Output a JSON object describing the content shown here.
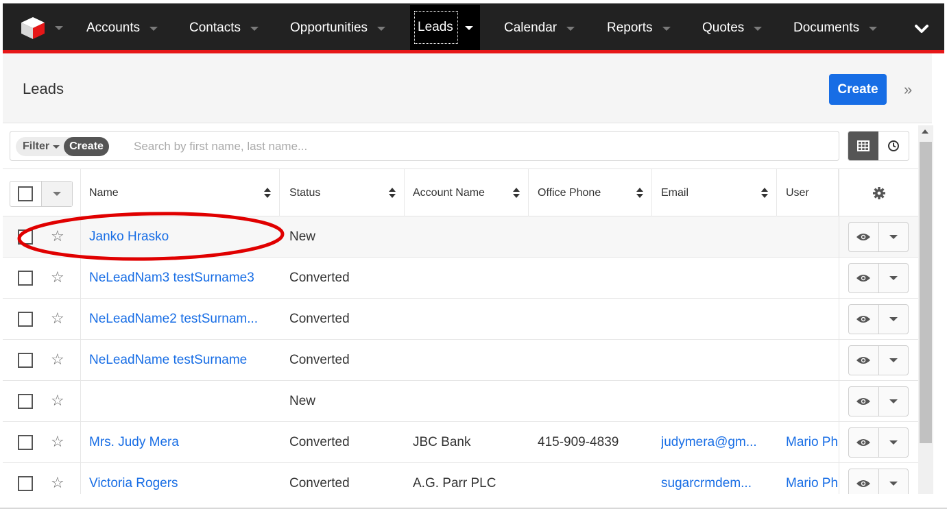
{
  "nav": {
    "logo_icon": "sugarcube-logo-icon",
    "items": [
      {
        "label": "Accounts"
      },
      {
        "label": "Contacts"
      },
      {
        "label": "Opportunities"
      },
      {
        "label": "Leads",
        "active": true
      },
      {
        "label": "Calendar"
      },
      {
        "label": "Reports"
      },
      {
        "label": "Quotes"
      },
      {
        "label": "Documents"
      }
    ],
    "more_icon": "chevron-down-icon"
  },
  "header": {
    "title": "Leads",
    "create_label": "Create",
    "collapse_icon": "double-chevron-right-icon"
  },
  "filter": {
    "filter_label": "Filter",
    "create_label": "Create",
    "search_placeholder": "Search by first name, last name...",
    "views": [
      {
        "icon": "grid-icon",
        "active": true
      },
      {
        "icon": "clock-icon",
        "active": false
      }
    ]
  },
  "table": {
    "columns": [
      "Name",
      "Status",
      "Account Name",
      "Office Phone",
      "Email",
      "User"
    ],
    "settings_icon": "gear-icon",
    "rows": [
      {
        "name": "Janko Hrasko",
        "status": "New",
        "account": "",
        "phone": "",
        "email": "",
        "user": "",
        "highlighted": true
      },
      {
        "name": "NeLeadNam3 testSurname3",
        "status": "Converted",
        "account": "",
        "phone": "",
        "email": "",
        "user": ""
      },
      {
        "name": "NeLeadName2 testSurnam...",
        "status": "Converted",
        "account": "",
        "phone": "",
        "email": "",
        "user": ""
      },
      {
        "name": "NeLeadName testSurname",
        "status": "Converted",
        "account": "",
        "phone": "",
        "email": "",
        "user": ""
      },
      {
        "name": "",
        "status": "New",
        "account": "",
        "phone": "",
        "email": "",
        "user": ""
      },
      {
        "name": "Mrs. Judy Mera",
        "status": "Converted",
        "account": "JBC Bank",
        "phone": "415-909-4839",
        "email": "judymera@gm...",
        "user": "Mario Ph"
      },
      {
        "name": "Victoria Rogers",
        "status": "Converted",
        "account": "A.G. Parr PLC",
        "phone": "",
        "email": "sugarcrmdem...",
        "user": "Mario Ph"
      }
    ]
  },
  "colors": {
    "nav_bg": "#222222",
    "accent_red": "#e61718",
    "link_blue": "#176de5",
    "annotation_red": "#e00000"
  }
}
